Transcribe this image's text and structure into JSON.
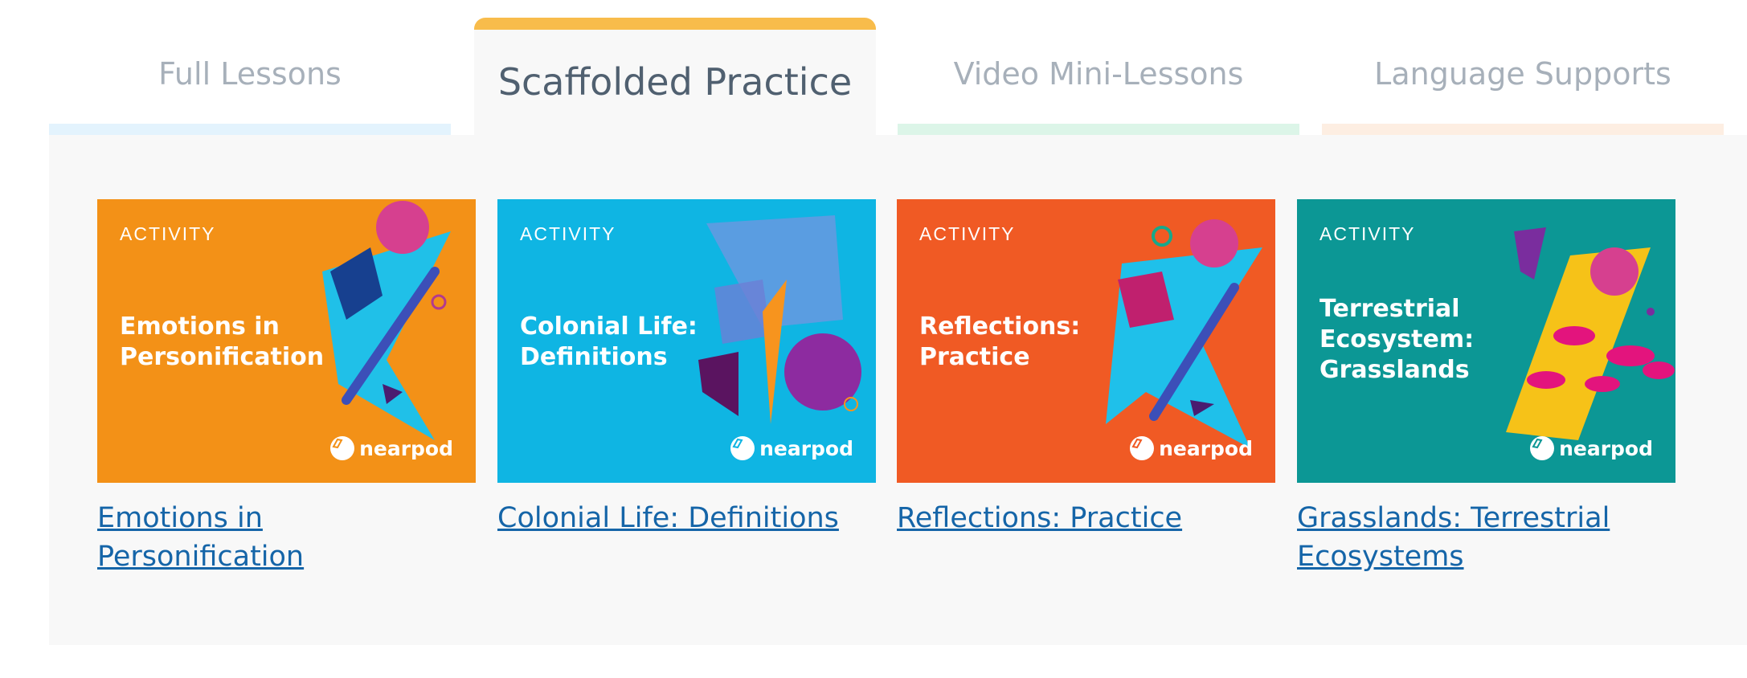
{
  "tabs": [
    {
      "label": "Full Lessons",
      "active": false
    },
    {
      "label": "Scaffolded Practice",
      "active": true
    },
    {
      "label": "Video Mini-Lessons",
      "active": false
    },
    {
      "label": "Language Supports",
      "active": false
    }
  ],
  "colors": {
    "active_tab_accent": "#f8bc4b",
    "link": "#1565a8",
    "panel_bg": "#f8f8f8"
  },
  "cards": [
    {
      "eyebrow": "ACTIVITY",
      "thumb_title": "Emotions in\nPersonification",
      "brand": "nearpod",
      "link": "Emotions in Personification",
      "bg": "#f39117"
    },
    {
      "eyebrow": "ACTIVITY",
      "thumb_title": "Colonial Life:\nDefinitions",
      "brand": "nearpod",
      "link": "Colonial Life: Definitions",
      "bg": "#0fb5e3"
    },
    {
      "eyebrow": "ACTIVITY",
      "thumb_title": "Reflections:\nPractice",
      "brand": "nearpod",
      "link": "Reflections: Practice",
      "bg": "#f05a24"
    },
    {
      "eyebrow": "ACTIVITY",
      "thumb_title": "Terrestrial\nEcosystem:\nGrasslands",
      "brand": "nearpod",
      "link": "Grasslands: Terrestrial Ecosystems",
      "bg": "#0c9795"
    }
  ]
}
